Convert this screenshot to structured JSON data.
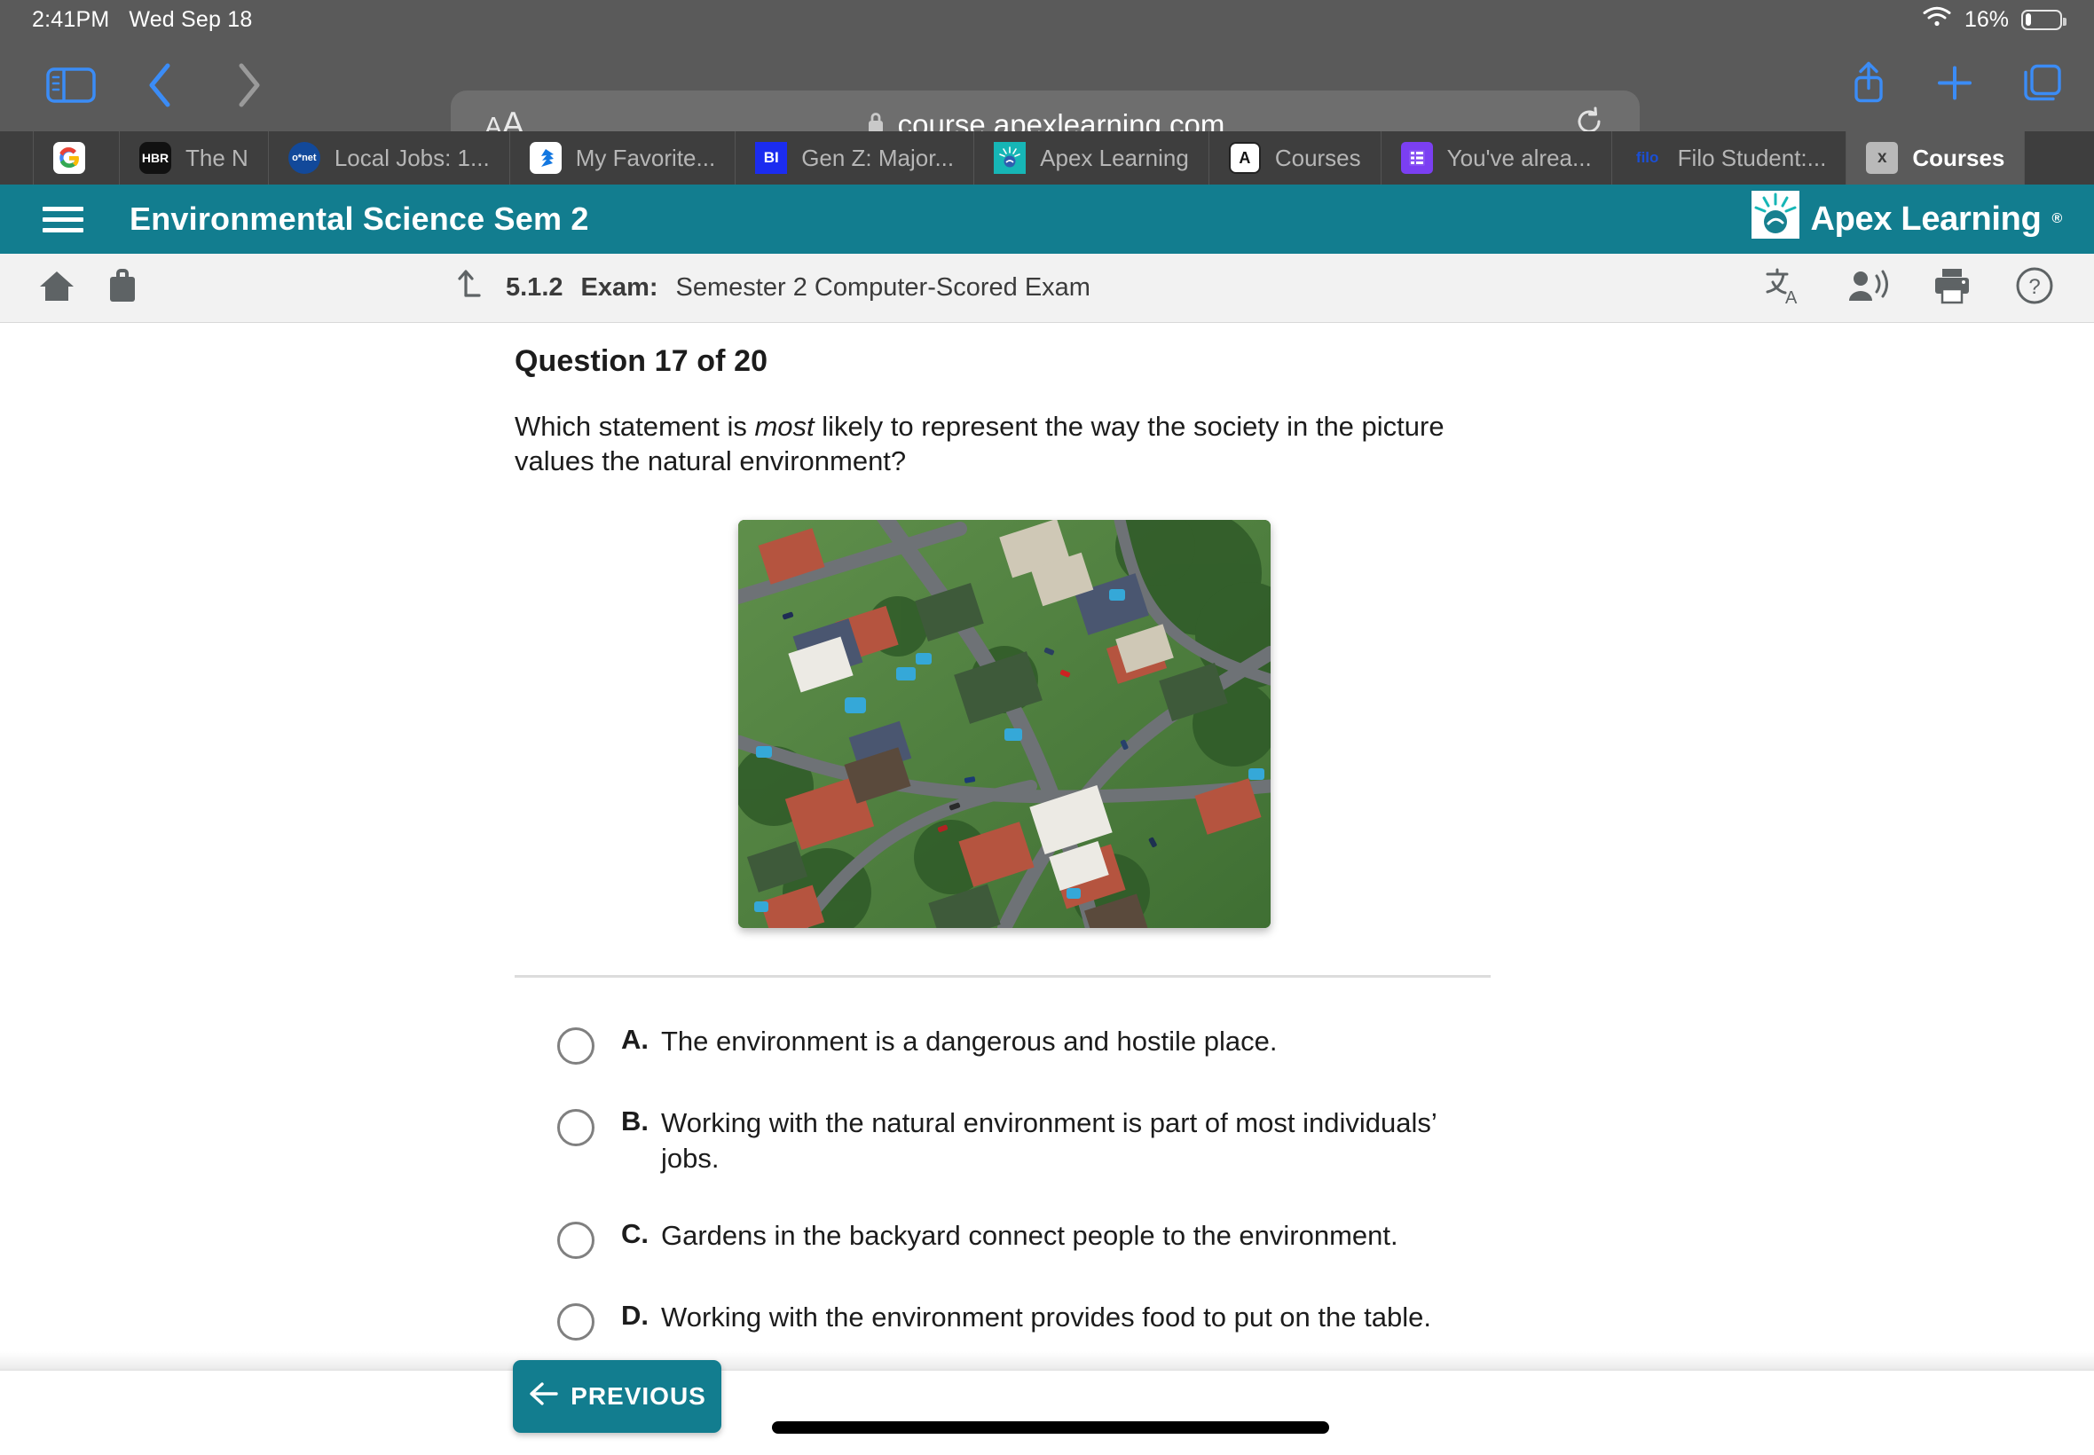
{
  "status_bar": {
    "time": "2:41PM",
    "date": "Wed Sep 18",
    "battery_percent": "16%",
    "wifi_icon": "wifi-icon",
    "battery_icon": "battery-icon"
  },
  "browser": {
    "sidebar_icon": "sidebar-toggle-icon",
    "back_icon": "chevron-left-icon",
    "forward_icon": "chevron-right-icon",
    "aa_label": "A",
    "aa_label_big": "A",
    "url": "course.apexlearning.com",
    "lock_icon": "lock-icon",
    "reload_icon": "reload-icon",
    "share_icon": "share-icon",
    "new_tab_icon": "plus-icon",
    "tabs_overview_icon": "tabs-icon",
    "tabs": [
      {
        "title": "",
        "favicon_text": "",
        "favicon_kind": "blank",
        "active": false
      },
      {
        "title": "",
        "favicon_text": "G",
        "favicon_kind": "google",
        "active": false
      },
      {
        "title": "The N",
        "favicon_text": "HBR",
        "favicon_kind": "hbr",
        "active": false
      },
      {
        "title": "Local Jobs: 1...",
        "favicon_text": "o*net",
        "favicon_kind": "onet",
        "active": false
      },
      {
        "title": "My Favorite...",
        "favicon_text": "Z",
        "favicon_kind": "zillow",
        "active": false
      },
      {
        "title": "Gen Z: Major...",
        "favicon_text": "BI",
        "favicon_kind": "bi",
        "active": false
      },
      {
        "title": "Apex Learning",
        "favicon_text": "",
        "favicon_kind": "apex",
        "active": false
      },
      {
        "title": "Courses",
        "favicon_text": "A",
        "favicon_kind": "apexa",
        "active": false
      },
      {
        "title": "You've alrea...",
        "favicon_text": "",
        "favicon_kind": "slides",
        "active": false
      },
      {
        "title": "Filo Student:...",
        "favicon_text": "filo",
        "favicon_kind": "filo",
        "active": false
      },
      {
        "title": "Courses",
        "favicon_text": "x",
        "favicon_kind": "x",
        "active": true
      }
    ]
  },
  "app_header": {
    "menu_icon": "hamburger-menu-icon",
    "course_title": "Environmental Science Sem 2",
    "brand": "Apex Learning",
    "brand_mark": "apex-lightbulb-logo",
    "brand_trademark": "®",
    "background_color": "#127d8f"
  },
  "sub_toolbar": {
    "home_icon": "home-icon",
    "briefcase_icon": "briefcase-icon",
    "up_arrow_icon": "up-level-icon",
    "lesson_number": "5.1.2",
    "lesson_kind": "Exam:",
    "lesson_name": "Semester 2 Computer-Scored Exam",
    "translate_icon": "translate-icon",
    "read_aloud_icon": "read-aloud-icon",
    "print_icon": "print-icon",
    "help_icon": "help-icon"
  },
  "question": {
    "heading": "Question 17 of 20",
    "prompt_before": "Which statement is ",
    "prompt_emphasis": "most",
    "prompt_after": " likely to represent the way the society in the picture values the natural environment?",
    "image_alt": "aerial-photo-of-suburban-neighborhood",
    "options": [
      {
        "letter": "A.",
        "text": "The environment is a dangerous and hostile place.",
        "selected": false
      },
      {
        "letter": "B.",
        "text": "Working with the natural environment is part of most individuals’ jobs.",
        "selected": false
      },
      {
        "letter": "C.",
        "text": "Gardens in the backyard connect people to the environment.",
        "selected": false
      },
      {
        "letter": "D.",
        "text": "Working with the environment provides food to put on the table.",
        "selected": false
      }
    ]
  },
  "footer": {
    "previous_label": "PREVIOUS",
    "previous_arrow_icon": "arrow-left-icon",
    "home_indicator": "home-indicator"
  },
  "colors": {
    "teal": "#127d8f",
    "ipad_chrome": "#5a5a5a",
    "tab_strip": "#3e3e3e",
    "sub_toolbar": "#f2f2f2",
    "safari_blue": "#3b8cf6"
  }
}
